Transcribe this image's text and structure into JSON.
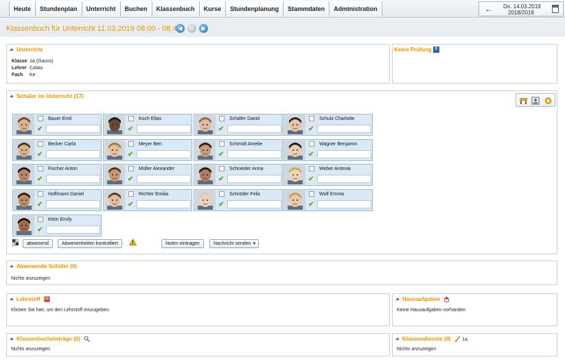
{
  "nav": [
    "Heute",
    "Stundenplan",
    "Unterricht",
    "Buchen",
    "Klassenbuch",
    "Kurse",
    "Stundenplanung",
    "Stammdaten",
    "Administration"
  ],
  "date": {
    "line1": "Do. 14.03.2019",
    "line2": "2018/2019"
  },
  "page_title": "Klassenbuch für Unterricht 11.03.2019 08:00 - 08:45",
  "unterricht": {
    "title": "Unterricht",
    "rows": [
      {
        "label": "Klasse",
        "value": "1a (Gauss)"
      },
      {
        "label": "Lehrer",
        "value": "Calias"
      },
      {
        "label": "Fach",
        "value": "Ke"
      }
    ]
  },
  "pruefung": {
    "title": "Keine Prüfung",
    "help": "?"
  },
  "schueler": {
    "title": "Schüler im Unterricht (17)",
    "students": [
      {
        "name": "Bauer Emil",
        "skin": "#d8b48e",
        "hair": "#6b4a2a"
      },
      {
        "name": "Koch Elias",
        "skin": "#6b4a33",
        "hair": "#1b1b1b"
      },
      {
        "name": "Schäfer David",
        "skin": "#e0bba0",
        "hair": "#8a6b4e"
      },
      {
        "name": "Schulz Charlotte",
        "skin": "#e6c5a6",
        "hair": "#2b2018"
      },
      {
        "name": "Becker Carla",
        "skin": "#d9b08a",
        "hair": "#4a2e1c"
      },
      {
        "name": "Meyer Ben",
        "skin": "#e3c09c",
        "hair": "#a07a42"
      },
      {
        "name": "Schmidt Amelie",
        "skin": "#c89a7a",
        "hair": "#2a1c14"
      },
      {
        "name": "Wagner Benjamin",
        "skin": "#e8cdb2",
        "hair": "#1a1a1a"
      },
      {
        "name": "Fischer Anton",
        "skin": "#b98562",
        "hair": "#1c130d"
      },
      {
        "name": "Müller Alexander",
        "skin": "#c99676",
        "hair": "#4b3322"
      },
      {
        "name": "Schneider Anna",
        "skin": "#b07b5c",
        "hair": "#20160f"
      },
      {
        "name": "Weber Antonia",
        "skin": "#f0d5b5",
        "hair": "#c9a560"
      },
      {
        "name": "Hoffmann Daniel",
        "skin": "#c08a66",
        "hair": "#2a1c12"
      },
      {
        "name": "Richter Emilia",
        "skin": "#e2bd9b",
        "hair": "#5a3b22"
      },
      {
        "name": "Schröder Felix",
        "skin": "#efd2b8",
        "hair": "#d8cdb8"
      },
      {
        "name": "Wolf Emma",
        "skin": "#ecc9a4",
        "hair": "#c59a55"
      },
      {
        "name": "Klein Emily",
        "skin": "#9a6a4a",
        "hair": "#1a120c"
      }
    ],
    "buttons": {
      "abwesend": "abwesend",
      "kontrolliert": "Abwesenheiten kontrolliert",
      "noten": "Noten eintragen",
      "nachricht": "Nachricht senden"
    }
  },
  "abwesende": {
    "title": "Abwesende Schüler (0)",
    "text": "Nichts anzuzeigen"
  },
  "lehrstoff": {
    "title": "Lehrstoff",
    "text": "Klicken Sie hier, um den Lehrstoff einzugeben."
  },
  "hausaufgaben": {
    "title": "Hausaufgaben",
    "text": "Keine Hausaufgaben vorhanden"
  },
  "eintraege": {
    "title": "Klassenbucheinträge (0)",
    "text": "Nichts anzuzeigen"
  },
  "dienste": {
    "title": "Klassendienste (0)",
    "klasse": "1a",
    "text": "Nichts anzuzeigen"
  }
}
